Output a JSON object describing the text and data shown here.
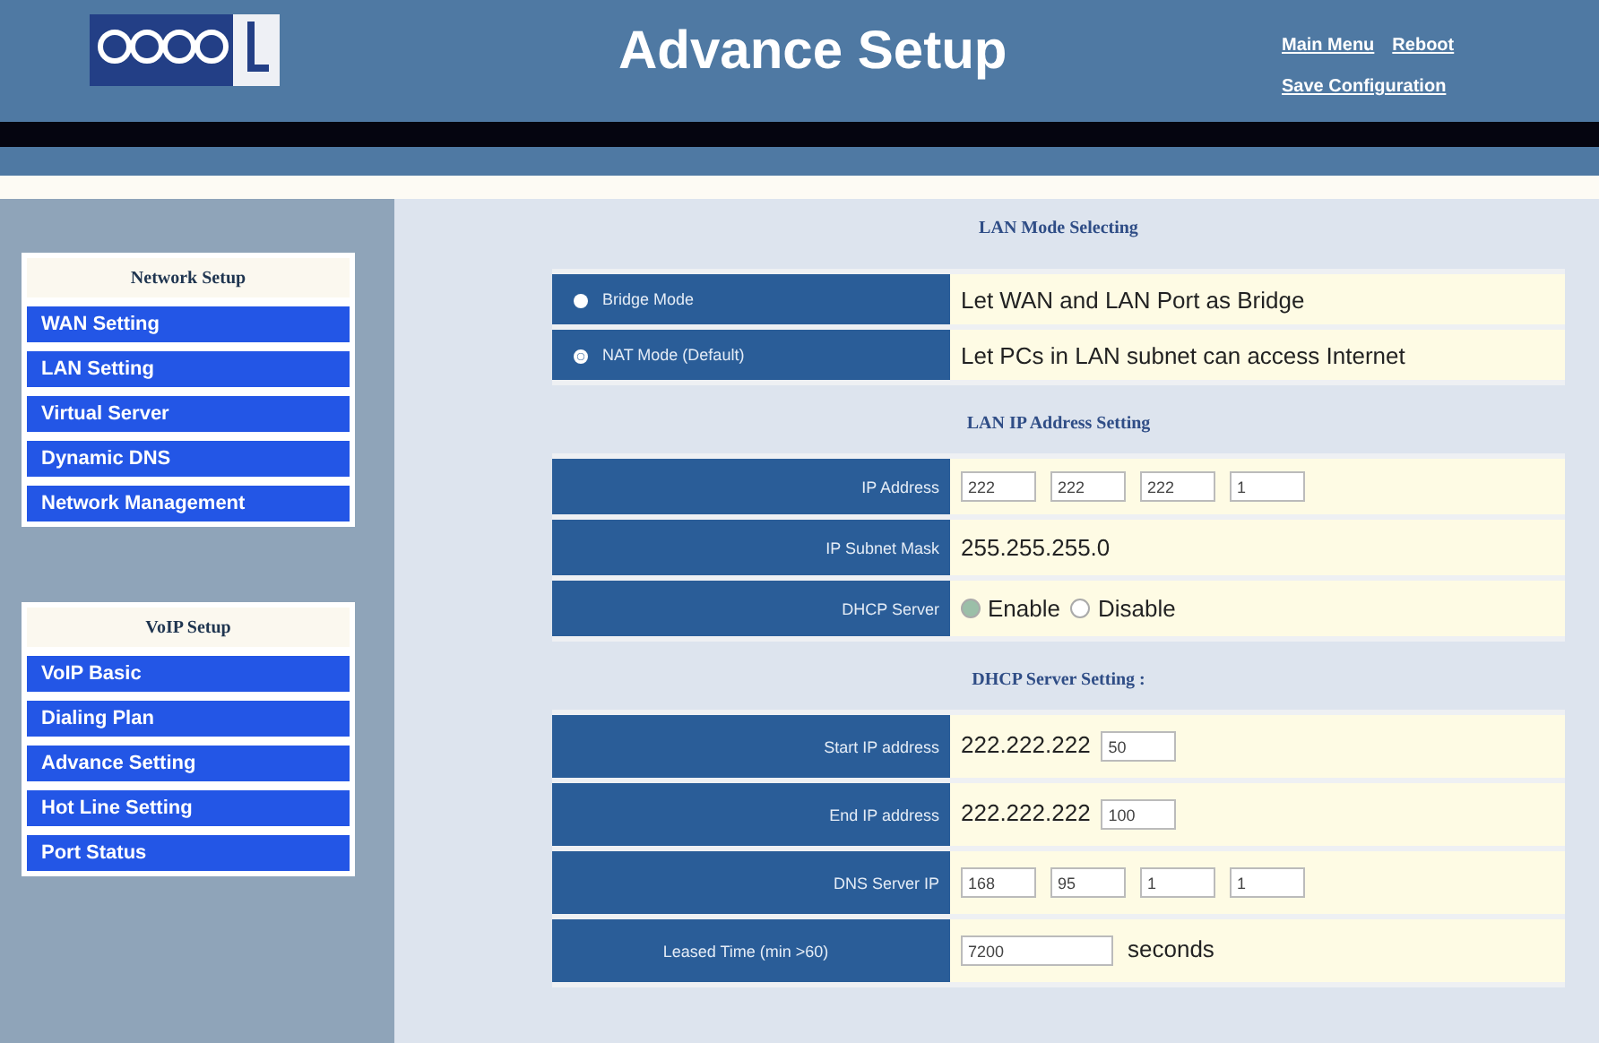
{
  "header": {
    "title": "Advance Setup",
    "links": [
      "Main Menu",
      "Reboot",
      "Save Configuration"
    ]
  },
  "sidebar": {
    "groups": [
      {
        "title": "Network Setup",
        "items": [
          "WAN Setting",
          "LAN Setting",
          "Virtual Server",
          "Dynamic DNS",
          "Network Management"
        ]
      },
      {
        "title": "VoIP Setup",
        "items": [
          "VoIP Basic",
          "Dialing Plan",
          "Advance Setting",
          "Hot Line Setting",
          "Port Status"
        ]
      }
    ]
  },
  "sections": [
    {
      "title": "LAN Mode Selecting",
      "rows": [
        {
          "kind": "radio",
          "label": "Bridge Mode",
          "selected": false,
          "description": "Let WAN and LAN Port as Bridge"
        },
        {
          "kind": "radio",
          "label": "NAT Mode (Default)",
          "selected": true,
          "description": "Let PCs in LAN subnet can access Internet"
        }
      ]
    },
    {
      "title": "LAN IP Address Setting",
      "rows": [
        {
          "kind": "octets",
          "label": "IP Address",
          "values": [
            "222",
            "222",
            "222",
            "1"
          ]
        },
        {
          "kind": "text",
          "label": "IP Subnet Mask",
          "value": "255.255.255.0"
        },
        {
          "kind": "choice",
          "label": "DHCP Server",
          "options": [
            {
              "label": "Enable",
              "selected": true
            },
            {
              "label": "Disable",
              "selected": false
            }
          ]
        }
      ]
    },
    {
      "title": "DHCP Server Setting :",
      "rows": [
        {
          "kind": "prefix",
          "label": "Start IP address",
          "prefix": "222.222.222",
          "value": "50"
        },
        {
          "kind": "prefix",
          "label": "End IP address",
          "prefix": "222.222.222",
          "value": "100"
        },
        {
          "kind": "octets",
          "label": "DNS Server IP",
          "values": [
            "168",
            "95",
            "1",
            "1"
          ]
        },
        {
          "kind": "unit",
          "label": "Leased Time (min >60)",
          "value": "7200",
          "unit": "seconds"
        }
      ]
    }
  ]
}
